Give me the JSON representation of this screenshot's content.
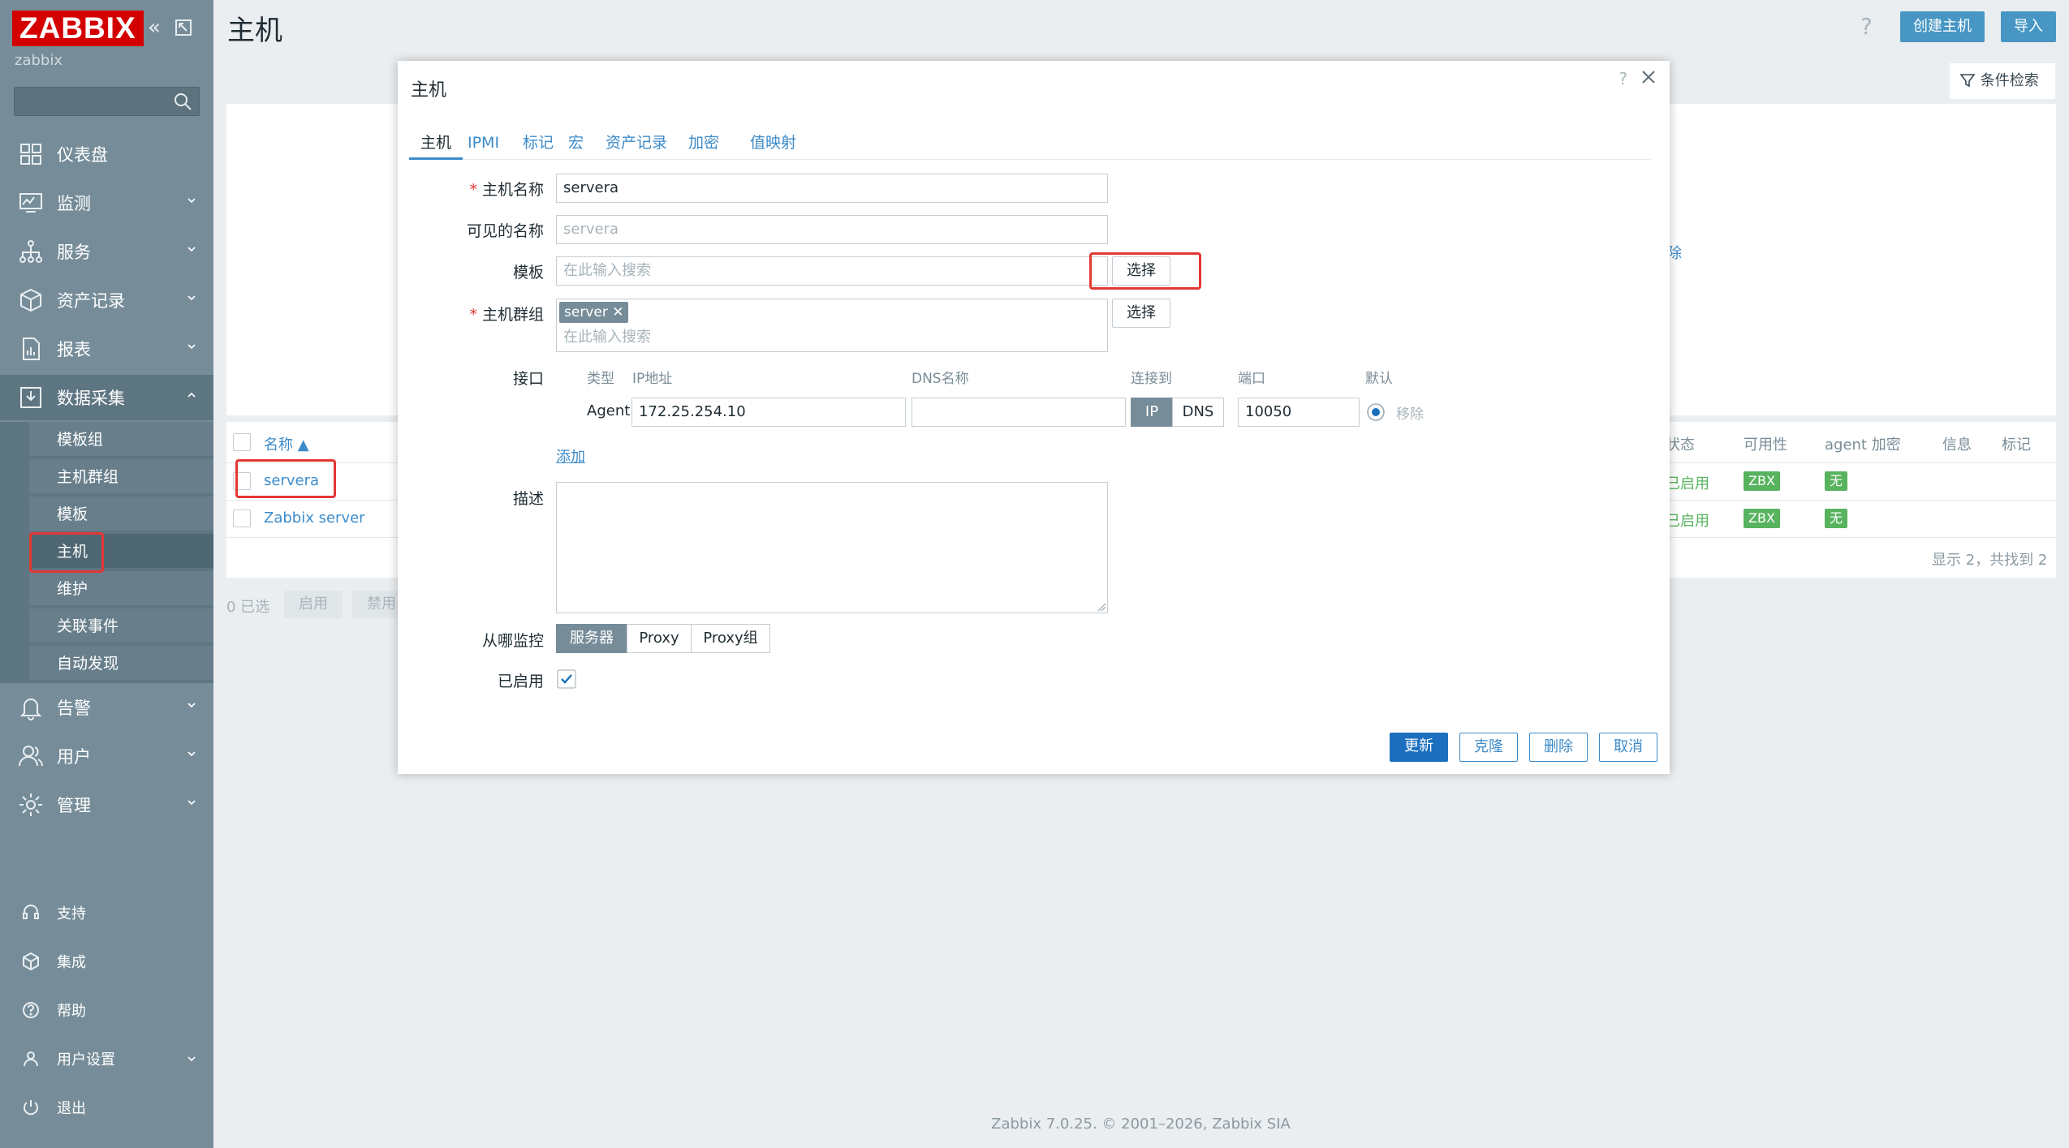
{
  "sidebar": {
    "logo": "ZABBIX",
    "server_name": "zabbix",
    "search_placeholder": "",
    "menu": [
      {
        "label": "仪表盘",
        "icon": "dashboard-icon"
      },
      {
        "label": "监测",
        "icon": "monitoring-icon"
      },
      {
        "label": "服务",
        "icon": "services-icon"
      },
      {
        "label": "资产记录",
        "icon": "inventory-icon"
      },
      {
        "label": "报表",
        "icon": "reports-icon"
      },
      {
        "label": "数据采集",
        "icon": "data-collection-icon"
      }
    ],
    "submenu": [
      "模板组",
      "主机群组",
      "模板",
      "主机",
      "维护",
      "关联事件",
      "自动发现"
    ],
    "menu2": [
      {
        "label": "告警",
        "icon": "bell-icon"
      },
      {
        "label": "用户",
        "icon": "users-icon"
      },
      {
        "label": "管理",
        "icon": "gear-icon"
      }
    ],
    "bottom": [
      {
        "label": "支持",
        "icon": "headset-icon"
      },
      {
        "label": "集成",
        "icon": "cube-icon"
      },
      {
        "label": "帮助",
        "icon": "help-icon"
      },
      {
        "label": "用户设置",
        "icon": "user-icon"
      },
      {
        "label": "退出",
        "icon": "power-icon"
      }
    ]
  },
  "header": {
    "title": "主机",
    "help": "?",
    "create_button": "创建主机",
    "import_button": "导入",
    "filter_tab": "条件检索"
  },
  "table": {
    "header_name": "名称 ▲",
    "header_status": "状态",
    "header_availability": "可用性",
    "header_agent_encryption": "agent 加密",
    "header_info": "信息",
    "header_tags": "标记",
    "filter_remove": "除",
    "rows": [
      {
        "name": "servera",
        "status": "已启用",
        "availability": "ZBX",
        "encryption": "无"
      },
      {
        "name": "Zabbix server",
        "status": "已启用",
        "availability": "ZBX",
        "encryption": "无"
      }
    ],
    "summary": "显示 2，共找到 2",
    "selected": "0 已选",
    "enable": "启用",
    "disable": "禁用"
  },
  "footer": "Zabbix 7.0.25. © 2001–2026, Zabbix SIA",
  "dialog": {
    "title": "主机",
    "help": "?",
    "tabs": [
      "主机",
      "IPMI",
      "标记",
      "宏",
      "资产记录",
      "加密",
      "值映射"
    ],
    "host_name_label": "主机名称",
    "host_name": "servera",
    "visible_name_label": "可见的名称",
    "visible_name_placeholder": "servera",
    "template_label": "模板",
    "template_placeholder": "在此输入搜索",
    "select": "选择",
    "groups_label": "主机群组",
    "group_chip": "server",
    "group_placeholder": "在此输入搜索",
    "interfaces_label": "接口",
    "if_headers": [
      "类型",
      "IP地址",
      "DNS名称",
      "连接到",
      "端口",
      "默认"
    ],
    "if_type": "Agent",
    "if_ip": "172.25.254.10",
    "if_dns": "",
    "if_connect_ip": "IP",
    "if_connect_dns": "DNS",
    "if_port": "10050",
    "if_remove": "移除",
    "add": "添加",
    "description_label": "描述",
    "description": "",
    "monitored_by_label": "从哪监控",
    "monitored_by": [
      "服务器",
      "Proxy",
      "Proxy组"
    ],
    "enabled_label": "已启用",
    "buttons": {
      "update": "更新",
      "clone": "克隆",
      "delete": "删除",
      "cancel": "取消"
    }
  },
  "colors": {
    "sidebar": "#768d99",
    "logo": "#d40000",
    "accent": "#3d8bc9",
    "primary_button": "#1b6fbe",
    "highlight": "#e33734",
    "status_green": "#58b35f"
  }
}
